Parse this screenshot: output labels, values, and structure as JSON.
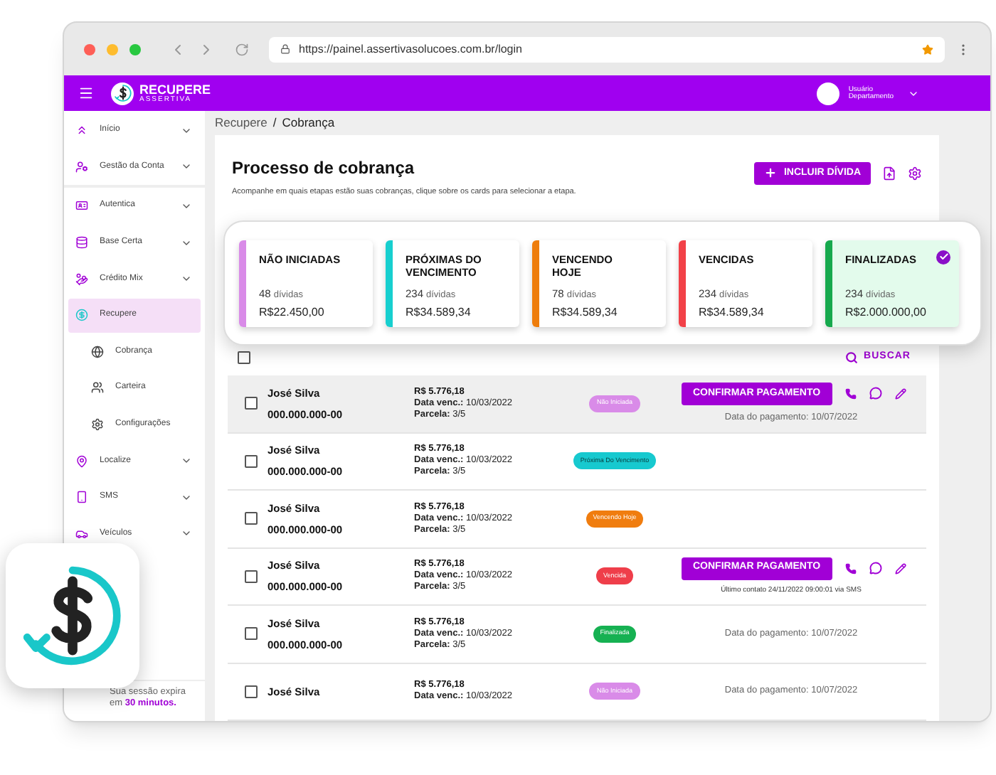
{
  "browser": {
    "url": "https://painel.assertivasolucoes.com.br/login"
  },
  "header": {
    "brand": "RECUPERE",
    "brand_sub": "ASSERTIVA",
    "user_name": "Usuário",
    "user_role": "Departamento"
  },
  "sidebar": {
    "items": [
      {
        "label": "Início",
        "kind": "group",
        "selected": false
      },
      {
        "label": "Gestão da Conta",
        "kind": "group",
        "selected": false
      },
      {
        "label": "Autentica",
        "kind": "group",
        "selected": false
      },
      {
        "label": "Base Certa",
        "kind": "group",
        "selected": false
      },
      {
        "label": "Crédito Mix",
        "kind": "group",
        "selected": false
      },
      {
        "label": "Recupere",
        "kind": "section",
        "selected": true
      },
      {
        "label": "Cobrança",
        "kind": "sub",
        "selected": false
      },
      {
        "label": "Carteira",
        "kind": "sub",
        "selected": false
      },
      {
        "label": "Configurações",
        "kind": "sub",
        "selected": false
      },
      {
        "label": "Localize",
        "kind": "group",
        "selected": false
      },
      {
        "label": "SMS",
        "kind": "group",
        "selected": false
      },
      {
        "label": "Veículos",
        "kind": "group",
        "selected": false
      }
    ],
    "session": "Sua sessão expira em **30 minutos.**"
  },
  "breadcrumb": {
    "items": [
      "Recupere",
      "Cobrança"
    ],
    "separator": "/"
  },
  "page": {
    "title": "Processo de cobrança",
    "subtitle": "Acompanhe em quais etapas estão suas cobranças, clique sobre os cards para selecionar a etapa.",
    "add_button": "INCLUIR DÍVIDA"
  },
  "stages": [
    {
      "title": "NÃO INICIADAS",
      "count": "48",
      "unit": "dívidas",
      "amount": "R$22.450,00",
      "color": "#d98be8",
      "selected": false
    },
    {
      "title": "PRÓXIMAS DO VENCIMENTO",
      "count": "234",
      "unit": "dívidas",
      "amount": "R$34.589,34",
      "color": "#17cfcf",
      "selected": false
    },
    {
      "title": "VENCENDO HOJE",
      "count": "78",
      "unit": "dívidas",
      "amount": "R$34.589,34",
      "color": "#ee7d0c",
      "selected": false
    },
    {
      "title": "VENCIDAS",
      "count": "234",
      "unit": "dívidas",
      "amount": "R$34.589,34",
      "color": "#f24148",
      "selected": false
    },
    {
      "title": "FINALIZADAS",
      "count": "234",
      "unit": "dívidas",
      "amount": "R$2.000.000,00",
      "color": "#16a94d",
      "selected": true
    }
  ],
  "table": {
    "select_all": {
      "checked": false
    },
    "search_button": "BUSCAR",
    "rows": [
      {
        "name": "José Silva",
        "cpf": "000.000.000-00",
        "amount": "R$ 5.776,18",
        "due": "**Data venc.:** 10/03/2022",
        "installment": "**Parcela:** 3/5",
        "status": "Não Iniciada",
        "color": "#d98be8",
        "confirm_button": "CONFIRMAR PAGAMENTO",
        "note": "Data do pagamento: 10/07/2022",
        "checked": false,
        "highlighted": true
      },
      {
        "name": "José Silva",
        "cpf": "000.000.000-00",
        "amount": "R$ 5.776,18",
        "due": "**Data venc.:** 10/03/2022",
        "installment": "**Parcela:** 3/5",
        "status": "Próxima Do Vencimento",
        "color": "#17c9cf",
        "checked": false,
        "highlighted": false
      },
      {
        "name": "José Silva",
        "cpf": "000.000.000-00",
        "amount": "R$ 5.776,18",
        "due": "**Data venc.:** 10/03/2022",
        "installment": "**Parcela:** 3/5",
        "status": "Vencendo Hoje",
        "color": "#f07d0f",
        "checked": false,
        "highlighted": false
      },
      {
        "name": "José Silva",
        "cpf": "000.000.000-00",
        "amount": "R$ 5.776,18",
        "due": "**Data venc.:** 10/03/2022",
        "installment": "**Parcela:** 3/5",
        "status": "Vencida",
        "color": "#ef3e4a",
        "confirm_button": "CONFIRMAR PAGAMENTO",
        "note": "Último contato 24/11/2022 09:00:01 via SMS",
        "checked": false,
        "highlighted": false
      },
      {
        "name": "José Silva",
        "cpf": "000.000.000-00",
        "amount": "R$ 5.776,18",
        "due": "**Data venc.:** 10/03/2022",
        "installment": "**Parcela:** 3/5",
        "status": "Finalizada",
        "color": "#16b152",
        "note": "Data do pagamento: 10/07/2022",
        "checked": false,
        "highlighted": false
      },
      {
        "name": "José Silva",
        "amount": "R$ 5.776,18",
        "due": "**Data venc.:** 10/03/2022",
        "status": "Não Iniciada",
        "color": "#d98be8",
        "note": "Data do pagamento: 10/07/2022",
        "checked": false,
        "highlighted": false
      }
    ]
  }
}
